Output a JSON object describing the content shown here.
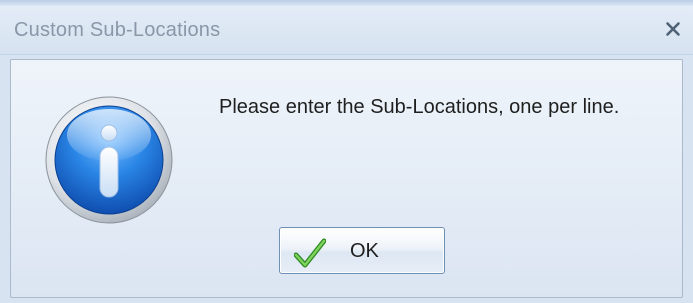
{
  "dialog": {
    "title": "Custom Sub-Locations",
    "close_icon": "close-icon",
    "message": "Please enter the Sub-Locations, one per line.",
    "icon": "info-icon",
    "ok_button": {
      "label": "OK",
      "icon": "checkmark-icon"
    }
  },
  "colors": {
    "title_text": "#8a97a8",
    "dialog_background": "#d7e3f1",
    "panel_border": "#aab9cc",
    "button_border": "#6f8fb5",
    "check_green": "#4fae3a",
    "info_blue": "#1f6fd0"
  }
}
